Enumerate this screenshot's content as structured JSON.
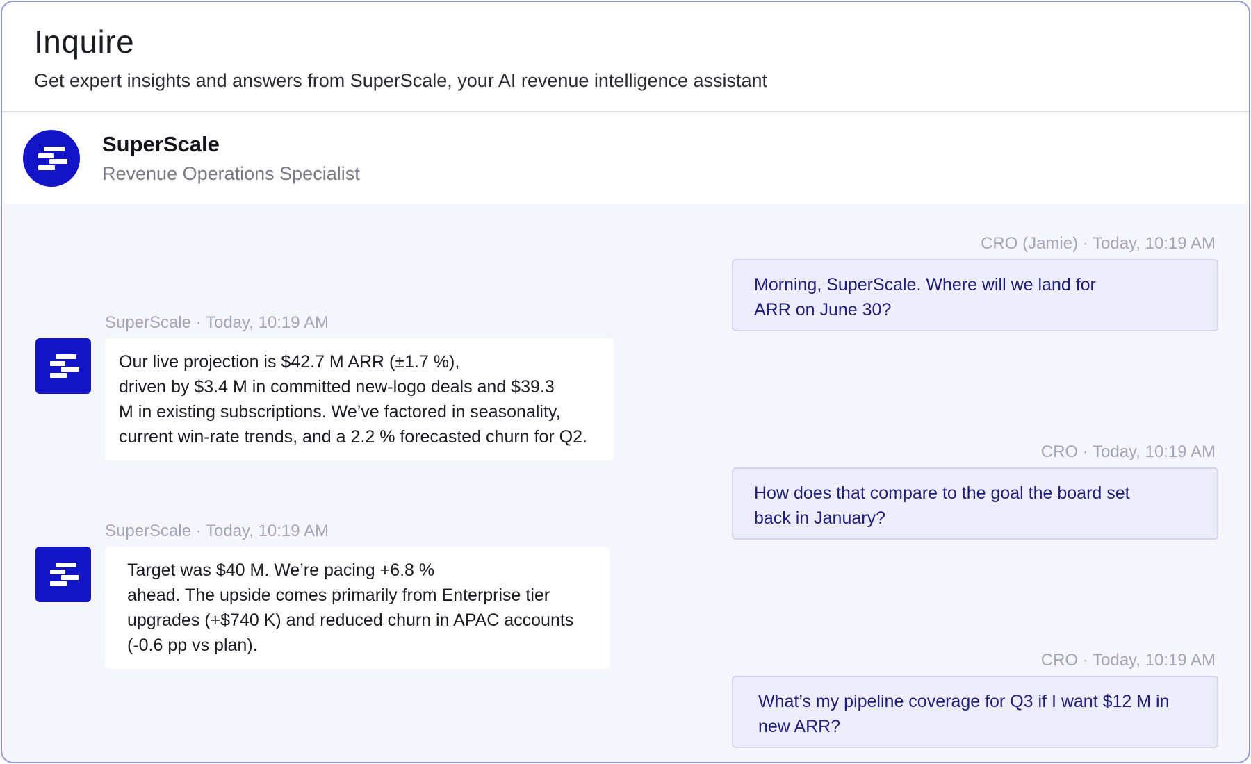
{
  "page": {
    "title": "Inquire",
    "subtitle": "Get expert insights and answers from SuperScale, your AI revenue intelligence assistant"
  },
  "agent": {
    "name": "SuperScale",
    "role": "Revenue Operations Specialist",
    "avatar_icon": "superscale-logo-icon"
  },
  "colors": {
    "brand": "#1414c7",
    "user_bubble": "#ececfb",
    "user_text": "#20207a",
    "frame_border": "#8f95dc"
  },
  "messages": [
    {
      "sender": "user",
      "meta": "CRO (Jamie) · Today, 10:19 AM",
      "lines": [
        "Morning, SuperScale. Where will we land for",
        "ARR on June 30?"
      ]
    },
    {
      "sender": "bot",
      "meta": "SuperScale · Today, 10:19 AM",
      "lines": [
        "Our live projection is $42.7 M ARR (±1.7 %),",
        "driven by $3.4 M in committed new-logo deals and $39.3",
        "M in existing subscriptions. We’ve factored in seasonality,",
        "current win-rate trends, and a 2.2 % forecasted churn for Q2."
      ]
    },
    {
      "sender": "user",
      "meta": "CRO · Today, 10:19 AM",
      "lines": [
        "How does that compare to the goal the board set",
        "back in January?"
      ]
    },
    {
      "sender": "bot",
      "meta": "SuperScale · Today, 10:19 AM",
      "lines": [
        "Target was $40 M. We’re pacing +6.8 %",
        "ahead. The upside comes primarily from Enterprise tier",
        "upgrades (+$740 K) and reduced churn in APAC accounts",
        "(-0.6 pp vs plan)."
      ]
    },
    {
      "sender": "user",
      "meta": "CRO · Today, 10:19 AM",
      "lines": [
        "What’s my pipeline coverage for Q3 if I want $12 M in",
        "new ARR?"
      ]
    }
  ]
}
